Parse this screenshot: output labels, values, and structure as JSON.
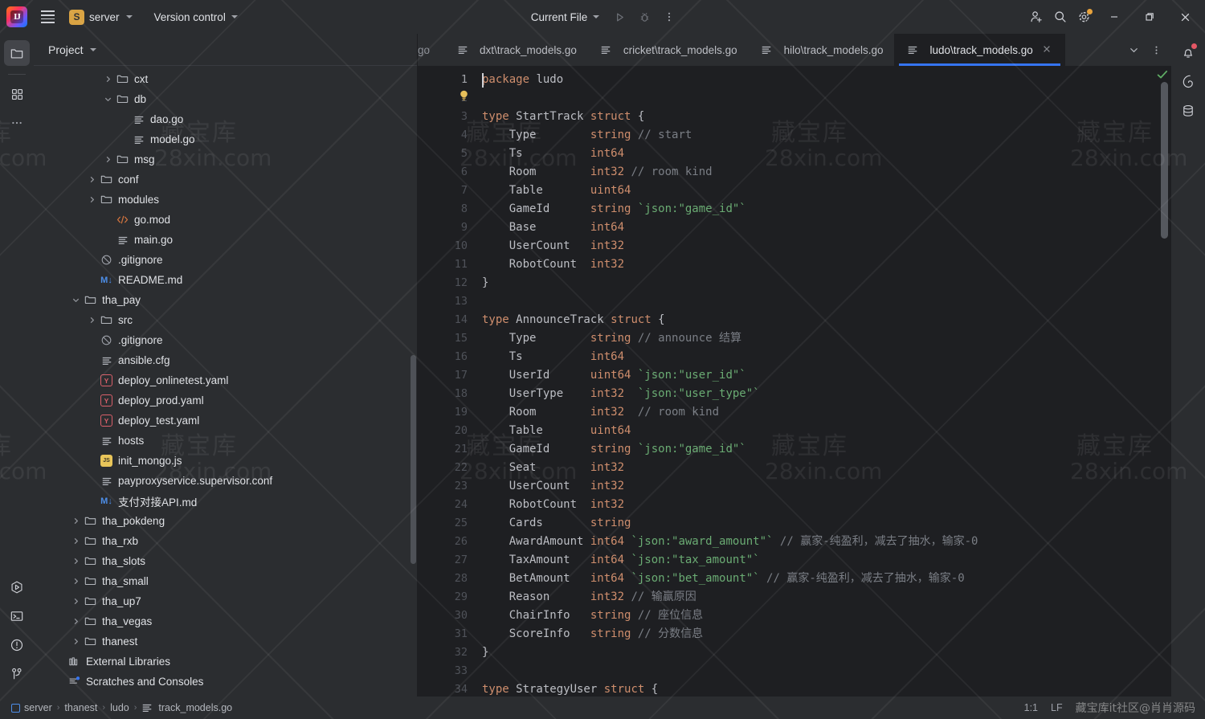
{
  "window": {
    "logo_icon": "intellij-logo-icon",
    "menu_icon": "hamburger-menu-icon",
    "project_badge": "S",
    "project_name": "server",
    "vcs_label": "Version control",
    "run_config": "Current File",
    "run_icon": "run-icon",
    "debug_icon": "debug-icon",
    "more_icon": "more-vertical-icon",
    "account_icon": "add-user-icon",
    "search_icon": "search-icon",
    "settings_icon": "gear-icon",
    "minimize_icon": "minimize-icon",
    "maximize_icon": "restore-icon",
    "close_icon": "close-icon"
  },
  "left_rail": {
    "items": [
      {
        "name": "project-tool-window",
        "icon": "folder-icon",
        "active": true
      },
      {
        "name": "structure-tool-window",
        "icon": "grid-squares-icon",
        "active": false
      },
      {
        "name": "more-tool-windows",
        "icon": "ellipsis-icon",
        "active": false
      }
    ],
    "bottom_items": [
      {
        "name": "run-tool-window",
        "icon": "run-hexagon-icon"
      },
      {
        "name": "terminal-tool-window",
        "icon": "terminal-icon"
      },
      {
        "name": "problems-tool-window",
        "icon": "warning-circle-icon"
      },
      {
        "name": "version-control-tool-window",
        "icon": "branch-icon"
      }
    ]
  },
  "right_rail": {
    "items": [
      {
        "name": "notifications",
        "icon": "bell-icon",
        "has_dot": true
      },
      {
        "name": "ai-assistant",
        "icon": "spiral-icon",
        "has_dot": false
      },
      {
        "name": "database",
        "icon": "database-icon",
        "has_dot": false
      }
    ]
  },
  "project_panel": {
    "title": "Project",
    "title_chevron_icon": "chevron-down-icon",
    "tree": [
      {
        "label": "cxt",
        "indent": 4,
        "arrow": "right",
        "icon": "folder-icon"
      },
      {
        "label": "db",
        "indent": 4,
        "arrow": "down",
        "icon": "folder-icon"
      },
      {
        "label": "dao.go",
        "indent": 5,
        "arrow": "none",
        "icon": "go-file-icon"
      },
      {
        "label": "model.go",
        "indent": 5,
        "arrow": "none",
        "icon": "go-file-icon"
      },
      {
        "label": "msg",
        "indent": 4,
        "arrow": "right",
        "icon": "folder-icon"
      },
      {
        "label": "conf",
        "indent": 3,
        "arrow": "right",
        "icon": "folder-icon"
      },
      {
        "label": "modules",
        "indent": 3,
        "arrow": "right",
        "icon": "folder-icon"
      },
      {
        "label": "go.mod",
        "indent": 4,
        "arrow": "none",
        "icon": "code-file-icon"
      },
      {
        "label": "main.go",
        "indent": 4,
        "arrow": "none",
        "icon": "go-file-icon"
      },
      {
        "label": ".gitignore",
        "indent": 3,
        "arrow": "none",
        "icon": "ignore-file-icon"
      },
      {
        "label": "README.md",
        "indent": 3,
        "arrow": "none",
        "icon": "markdown-file-icon"
      },
      {
        "label": "tha_pay",
        "indent": 2,
        "arrow": "down",
        "icon": "folder-icon"
      },
      {
        "label": "src",
        "indent": 3,
        "arrow": "right",
        "icon": "folder-icon"
      },
      {
        "label": ".gitignore",
        "indent": 3,
        "arrow": "none",
        "icon": "ignore-file-icon"
      },
      {
        "label": "ansible.cfg",
        "indent": 3,
        "arrow": "none",
        "icon": "text-file-icon"
      },
      {
        "label": "deploy_onlinetest.yaml",
        "indent": 3,
        "arrow": "none",
        "icon": "yaml-file-icon"
      },
      {
        "label": "deploy_prod.yaml",
        "indent": 3,
        "arrow": "none",
        "icon": "yaml-file-icon"
      },
      {
        "label": "deploy_test.yaml",
        "indent": 3,
        "arrow": "none",
        "icon": "yaml-file-icon"
      },
      {
        "label": "hosts",
        "indent": 3,
        "arrow": "none",
        "icon": "text-file-icon"
      },
      {
        "label": "init_mongo.js",
        "indent": 3,
        "arrow": "none",
        "icon": "js-file-icon"
      },
      {
        "label": "payproxyservice.supervisor.conf",
        "indent": 3,
        "arrow": "none",
        "icon": "text-file-icon"
      },
      {
        "label": "支付对接API.md",
        "indent": 3,
        "arrow": "none",
        "icon": "markdown-file-icon"
      },
      {
        "label": "tha_pokdeng",
        "indent": 2,
        "arrow": "right",
        "icon": "folder-icon"
      },
      {
        "label": "tha_rxb",
        "indent": 2,
        "arrow": "right",
        "icon": "folder-icon"
      },
      {
        "label": "tha_slots",
        "indent": 2,
        "arrow": "right",
        "icon": "folder-icon"
      },
      {
        "label": "tha_small",
        "indent": 2,
        "arrow": "right",
        "icon": "folder-icon"
      },
      {
        "label": "tha_up7",
        "indent": 2,
        "arrow": "right",
        "icon": "folder-icon"
      },
      {
        "label": "tha_vegas",
        "indent": 2,
        "arrow": "right",
        "icon": "folder-icon"
      },
      {
        "label": "thanest",
        "indent": 2,
        "arrow": "right",
        "icon": "folder-icon"
      },
      {
        "label": "External Libraries",
        "indent": 1,
        "arrow": "none",
        "icon": "libraries-icon"
      },
      {
        "label": "Scratches and Consoles",
        "indent": 1,
        "arrow": "none",
        "icon": "scratches-icon"
      }
    ]
  },
  "editor": {
    "tabs": [
      {
        "label": "go",
        "clipped": true,
        "active": false,
        "icon": "go-file-icon"
      },
      {
        "label": "dxt\\track_models.go",
        "clipped": false,
        "active": false,
        "icon": "go-file-icon"
      },
      {
        "label": "cricket\\track_models.go",
        "clipped": false,
        "active": false,
        "icon": "go-file-icon"
      },
      {
        "label": "hilo\\track_models.go",
        "clipped": false,
        "active": false,
        "icon": "go-file-icon"
      },
      {
        "label": "ludo\\track_models.go",
        "clipped": false,
        "active": true,
        "icon": "go-file-icon"
      }
    ],
    "tab_close_icon": "close-icon",
    "tab_list_icon": "chevron-down-icon",
    "tab_options_icon": "more-vertical-icon",
    "inspection_icon": "checkmark-ok-icon",
    "accent_color": "#3574f0",
    "first_line": 1,
    "last_line": 34,
    "lines": [
      {
        "n": 1,
        "tokens": [
          {
            "t": "package",
            "c": "kw"
          },
          {
            "t": " ludo",
            "c": "plain"
          }
        ]
      },
      {
        "n": 2,
        "tokens": []
      },
      {
        "n": 3,
        "tokens": [
          {
            "t": "type",
            "c": "kw"
          },
          {
            "t": " StartTrack ",
            "c": "plain"
          },
          {
            "t": "struct",
            "c": "kw"
          },
          {
            "t": " {",
            "c": "plain"
          }
        ]
      },
      {
        "n": 4,
        "tokens": [
          {
            "t": "    Type        ",
            "c": "plain"
          },
          {
            "t": "string",
            "c": "num"
          },
          {
            "t": " ",
            "c": "plain"
          },
          {
            "t": "// start",
            "c": "cmt"
          }
        ]
      },
      {
        "n": 5,
        "tokens": [
          {
            "t": "    Ts          ",
            "c": "plain"
          },
          {
            "t": "int64",
            "c": "num"
          }
        ]
      },
      {
        "n": 6,
        "tokens": [
          {
            "t": "    Room        ",
            "c": "plain"
          },
          {
            "t": "int32",
            "c": "num"
          },
          {
            "t": " ",
            "c": "plain"
          },
          {
            "t": "// room kind",
            "c": "cmt"
          }
        ]
      },
      {
        "n": 7,
        "tokens": [
          {
            "t": "    Table       ",
            "c": "plain"
          },
          {
            "t": "uint64",
            "c": "num"
          }
        ]
      },
      {
        "n": 8,
        "tokens": [
          {
            "t": "    GameId      ",
            "c": "plain"
          },
          {
            "t": "string",
            "c": "num"
          },
          {
            "t": " ",
            "c": "plain"
          },
          {
            "t": "`json:\"game_id\"`",
            "c": "str"
          }
        ]
      },
      {
        "n": 9,
        "tokens": [
          {
            "t": "    Base        ",
            "c": "plain"
          },
          {
            "t": "int64",
            "c": "num"
          }
        ]
      },
      {
        "n": 10,
        "tokens": [
          {
            "t": "    UserCount   ",
            "c": "plain"
          },
          {
            "t": "int32",
            "c": "num"
          }
        ]
      },
      {
        "n": 11,
        "tokens": [
          {
            "t": "    RobotCount  ",
            "c": "plain"
          },
          {
            "t": "int32",
            "c": "num"
          }
        ]
      },
      {
        "n": 12,
        "tokens": [
          {
            "t": "}",
            "c": "plain"
          }
        ]
      },
      {
        "n": 13,
        "tokens": []
      },
      {
        "n": 14,
        "tokens": [
          {
            "t": "type",
            "c": "kw"
          },
          {
            "t": " AnnounceTrack ",
            "c": "plain"
          },
          {
            "t": "struct",
            "c": "kw"
          },
          {
            "t": " {",
            "c": "plain"
          }
        ]
      },
      {
        "n": 15,
        "tokens": [
          {
            "t": "    Type        ",
            "c": "plain"
          },
          {
            "t": "string",
            "c": "num"
          },
          {
            "t": " ",
            "c": "plain"
          },
          {
            "t": "// announce 结算",
            "c": "cmt"
          }
        ]
      },
      {
        "n": 16,
        "tokens": [
          {
            "t": "    Ts          ",
            "c": "plain"
          },
          {
            "t": "int64",
            "c": "num"
          }
        ]
      },
      {
        "n": 17,
        "tokens": [
          {
            "t": "    UserId      ",
            "c": "plain"
          },
          {
            "t": "uint64",
            "c": "num"
          },
          {
            "t": " ",
            "c": "plain"
          },
          {
            "t": "`json:\"user_id\"`",
            "c": "str"
          }
        ]
      },
      {
        "n": 18,
        "tokens": [
          {
            "t": "    UserType    ",
            "c": "plain"
          },
          {
            "t": "int32",
            "c": "num"
          },
          {
            "t": "  ",
            "c": "plain"
          },
          {
            "t": "`json:\"user_type\"`",
            "c": "str"
          }
        ]
      },
      {
        "n": 19,
        "tokens": [
          {
            "t": "    Room        ",
            "c": "plain"
          },
          {
            "t": "int32",
            "c": "num"
          },
          {
            "t": "  ",
            "c": "plain"
          },
          {
            "t": "// room kind",
            "c": "cmt"
          }
        ]
      },
      {
        "n": 20,
        "tokens": [
          {
            "t": "    Table       ",
            "c": "plain"
          },
          {
            "t": "uint64",
            "c": "num"
          }
        ]
      },
      {
        "n": 21,
        "tokens": [
          {
            "t": "    GameId      ",
            "c": "plain"
          },
          {
            "t": "string",
            "c": "num"
          },
          {
            "t": " ",
            "c": "plain"
          },
          {
            "t": "`json:\"game_id\"`",
            "c": "str"
          }
        ]
      },
      {
        "n": 22,
        "tokens": [
          {
            "t": "    Seat        ",
            "c": "plain"
          },
          {
            "t": "int32",
            "c": "num"
          }
        ]
      },
      {
        "n": 23,
        "tokens": [
          {
            "t": "    UserCount   ",
            "c": "plain"
          },
          {
            "t": "int32",
            "c": "num"
          }
        ]
      },
      {
        "n": 24,
        "tokens": [
          {
            "t": "    RobotCount  ",
            "c": "plain"
          },
          {
            "t": "int32",
            "c": "num"
          }
        ]
      },
      {
        "n": 25,
        "tokens": [
          {
            "t": "    Cards       ",
            "c": "plain"
          },
          {
            "t": "string",
            "c": "num"
          }
        ]
      },
      {
        "n": 26,
        "tokens": [
          {
            "t": "    AwardAmount ",
            "c": "plain"
          },
          {
            "t": "int64",
            "c": "num"
          },
          {
            "t": " ",
            "c": "plain"
          },
          {
            "t": "`json:\"award_amount\"`",
            "c": "str"
          },
          {
            "t": " ",
            "c": "plain"
          },
          {
            "t": "// 赢家-纯盈利，减去了抽水，输家-0",
            "c": "cmt"
          }
        ]
      },
      {
        "n": 27,
        "tokens": [
          {
            "t": "    TaxAmount   ",
            "c": "plain"
          },
          {
            "t": "int64",
            "c": "num"
          },
          {
            "t": " ",
            "c": "plain"
          },
          {
            "t": "`json:\"tax_amount\"`",
            "c": "str"
          }
        ]
      },
      {
        "n": 28,
        "tokens": [
          {
            "t": "    BetAmount   ",
            "c": "plain"
          },
          {
            "t": "int64",
            "c": "num"
          },
          {
            "t": " ",
            "c": "plain"
          },
          {
            "t": "`json:\"bet_amount\"`",
            "c": "str"
          },
          {
            "t": " ",
            "c": "plain"
          },
          {
            "t": "// 赢家-纯盈利，减去了抽水，输家-0",
            "c": "cmt"
          }
        ]
      },
      {
        "n": 29,
        "tokens": [
          {
            "t": "    Reason      ",
            "c": "plain"
          },
          {
            "t": "int32",
            "c": "num"
          },
          {
            "t": " ",
            "c": "plain"
          },
          {
            "t": "// 输赢原因",
            "c": "cmt"
          }
        ]
      },
      {
        "n": 30,
        "tokens": [
          {
            "t": "    ChairInfo   ",
            "c": "plain"
          },
          {
            "t": "string",
            "c": "num"
          },
          {
            "t": " ",
            "c": "plain"
          },
          {
            "t": "// 座位信息",
            "c": "cmt"
          }
        ]
      },
      {
        "n": 31,
        "tokens": [
          {
            "t": "    ScoreInfo   ",
            "c": "plain"
          },
          {
            "t": "string",
            "c": "num"
          },
          {
            "t": " ",
            "c": "plain"
          },
          {
            "t": "// 分数信息",
            "c": "cmt"
          }
        ]
      },
      {
        "n": 32,
        "tokens": [
          {
            "t": "}",
            "c": "plain"
          }
        ]
      },
      {
        "n": 33,
        "tokens": []
      },
      {
        "n": 34,
        "tokens": [
          {
            "t": "type",
            "c": "kw"
          },
          {
            "t": " StrategyUser ",
            "c": "plain"
          },
          {
            "t": "struct",
            "c": "kw"
          },
          {
            "t": " {",
            "c": "plain"
          }
        ]
      }
    ]
  },
  "status_bar": {
    "breadcrumbs": [
      {
        "label": "server",
        "icon": "module-icon"
      },
      {
        "label": "thanest",
        "icon": "none"
      },
      {
        "label": "ludo",
        "icon": "none"
      },
      {
        "label": "track_models.go",
        "icon": "go-file-icon"
      }
    ],
    "separator": "›",
    "caret_position": "1:1",
    "line_separator": "LF",
    "watermark": "藏宝库it社区@肖肖源码"
  },
  "watermarks": {
    "cn": "藏宝库",
    "en": "28xin.com"
  }
}
